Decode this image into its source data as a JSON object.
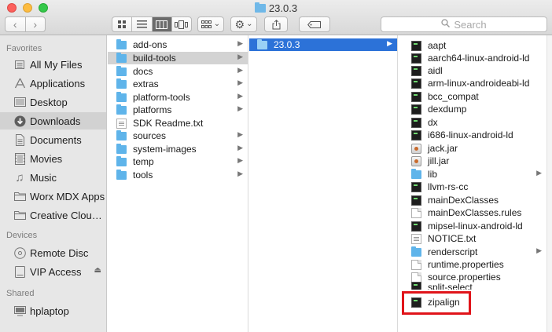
{
  "window": {
    "title": "23.0.3"
  },
  "toolbar": {
    "back_glyph": "‹",
    "forward_glyph": "›",
    "search_placeholder": "Search",
    "arrange_caret": "⌄",
    "action_caret": "⌄"
  },
  "sidebar": {
    "favorites_label": "Favorites",
    "devices_label": "Devices",
    "shared_label": "Shared",
    "favorites": [
      {
        "label": "All My Files",
        "icon": "all-files-icon"
      },
      {
        "label": "Applications",
        "icon": "applications-icon"
      },
      {
        "label": "Desktop",
        "icon": "desktop-icon"
      },
      {
        "label": "Downloads",
        "icon": "downloads-icon",
        "selected": true
      },
      {
        "label": "Documents",
        "icon": "documents-icon"
      },
      {
        "label": "Movies",
        "icon": "movies-icon"
      },
      {
        "label": "Music",
        "icon": "music-icon"
      },
      {
        "label": "Worx MDX Apps",
        "icon": "folder-icon"
      },
      {
        "label": "Creative Clou…",
        "icon": "folder-icon"
      }
    ],
    "devices": [
      {
        "label": "Remote Disc",
        "icon": "remote-disc-icon"
      },
      {
        "label": "VIP Access",
        "icon": "drive-icon",
        "eject": "⏏"
      }
    ],
    "shared": [
      {
        "label": "hplaptop",
        "icon": "computer-icon"
      }
    ]
  },
  "columns": {
    "col1": [
      {
        "name": "add-ons",
        "kind": "folder",
        "has_children": true
      },
      {
        "name": "build-tools",
        "kind": "folder",
        "has_children": true,
        "state": "dim"
      },
      {
        "name": "docs",
        "kind": "folder",
        "has_children": true
      },
      {
        "name": "extras",
        "kind": "folder",
        "has_children": true
      },
      {
        "name": "platform-tools",
        "kind": "folder",
        "has_children": true
      },
      {
        "name": "platforms",
        "kind": "folder",
        "has_children": true
      },
      {
        "name": "SDK Readme.txt",
        "kind": "txt",
        "has_children": false
      },
      {
        "name": "sources",
        "kind": "folder",
        "has_children": true
      },
      {
        "name": "system-images",
        "kind": "folder",
        "has_children": true
      },
      {
        "name": "temp",
        "kind": "folder",
        "has_children": true
      },
      {
        "name": "tools",
        "kind": "folder",
        "has_children": true
      }
    ],
    "col2": [
      {
        "name": "23.0.3",
        "kind": "folder",
        "has_children": true,
        "state": "blue"
      }
    ],
    "col3": [
      {
        "name": "aapt",
        "kind": "exec"
      },
      {
        "name": "aarch64-linux-android-ld",
        "kind": "exec"
      },
      {
        "name": "aidl",
        "kind": "exec"
      },
      {
        "name": "arm-linux-androideabi-ld",
        "kind": "exec"
      },
      {
        "name": "bcc_compat",
        "kind": "exec"
      },
      {
        "name": "dexdump",
        "kind": "exec"
      },
      {
        "name": "dx",
        "kind": "exec"
      },
      {
        "name": "i686-linux-android-ld",
        "kind": "exec"
      },
      {
        "name": "jack.jar",
        "kind": "jar"
      },
      {
        "name": "jill.jar",
        "kind": "jar"
      },
      {
        "name": "lib",
        "kind": "folder",
        "has_children": true
      },
      {
        "name": "llvm-rs-cc",
        "kind": "exec"
      },
      {
        "name": "mainDexClasses",
        "kind": "exec"
      },
      {
        "name": "mainDexClasses.rules",
        "kind": "doc"
      },
      {
        "name": "mipsel-linux-android-ld",
        "kind": "exec"
      },
      {
        "name": "NOTICE.txt",
        "kind": "txt"
      },
      {
        "name": "renderscript",
        "kind": "folder",
        "has_children": true
      },
      {
        "name": "runtime.properties",
        "kind": "doc"
      },
      {
        "name": "source.properties",
        "kind": "doc"
      },
      {
        "name": "split-select",
        "kind": "exec"
      },
      {
        "name": "zipalign",
        "kind": "exec",
        "highlighted": true
      }
    ]
  },
  "colors": {
    "selection_blue": "#2c72d8",
    "highlight_red": "#e0141a",
    "folder_blue": "#5fb4ea"
  }
}
